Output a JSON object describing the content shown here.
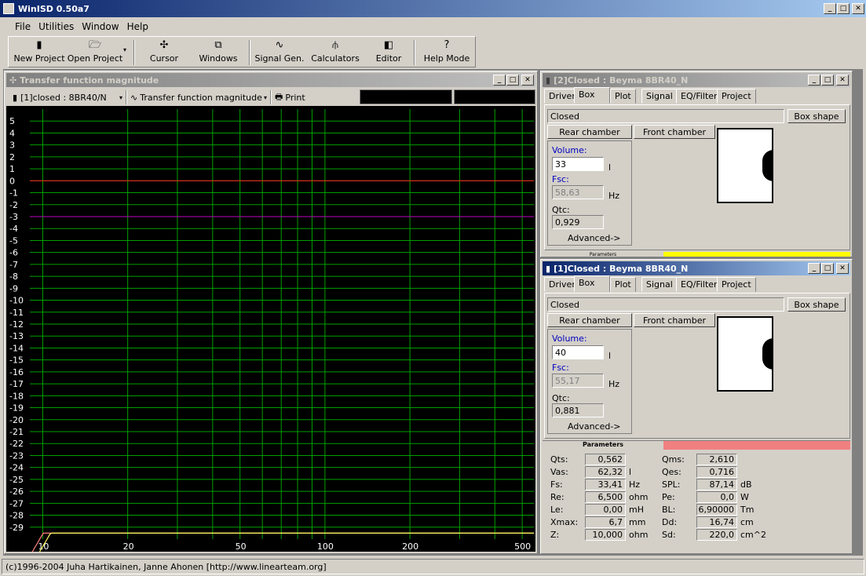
{
  "app_title": "WinISD 0.50a7",
  "menu": [
    "File",
    "Utilities",
    "Window",
    "Help"
  ],
  "toolbar": {
    "new_project": "New Project",
    "open_project": "Open Project",
    "cursor": "Cursor",
    "windows": "Windows",
    "signal_gen": "Signal Gen.",
    "calculators": "Calculators",
    "editor": "Editor",
    "help_mode": "Help Mode"
  },
  "graph_window": {
    "title": "Transfer function magnitude",
    "project_select": "[1]closed : 8BR40/N",
    "graph_select": "Transfer function magnitude",
    "print_label": "Print"
  },
  "box2": {
    "title": "[2]Closed : Beyma 8BR40_N",
    "tabs": [
      "Driver",
      "Box",
      "Plot",
      "Signal",
      "EQ/Filter",
      "Project"
    ],
    "box_type": "Closed",
    "box_shape_btn": "Box shape",
    "rear_chamber_btn": "Rear chamber",
    "front_chamber_btn": "Front chamber",
    "volume_label": "Volume:",
    "volume_value": "33",
    "volume_unit": "l",
    "fsc_label": "Fsc:",
    "fsc_value": "58,63",
    "fsc_unit": "Hz",
    "qtc_label": "Qtc:",
    "qtc_value": "0,929",
    "advanced_btn": "Advanced->",
    "params_label": "Parameters"
  },
  "box1": {
    "title": "[1]Closed : Beyma 8BR40_N",
    "tabs": [
      "Driver",
      "Box",
      "Plot",
      "Signal",
      "EQ/Filter",
      "Project"
    ],
    "box_type": "Closed",
    "box_shape_btn": "Box shape",
    "rear_chamber_btn": "Rear chamber",
    "front_chamber_btn": "Front chamber",
    "volume_label": "Volume:",
    "volume_value": "40",
    "volume_unit": "l",
    "fsc_label": "Fsc:",
    "fsc_value": "55,17",
    "fsc_unit": "Hz",
    "qtc_label": "Qtc:",
    "qtc_value": "0,881",
    "advanced_btn": "Advanced->"
  },
  "parameters": {
    "header": "Parameters",
    "left": [
      {
        "name": "Qts:",
        "value": "0,562",
        "unit": ""
      },
      {
        "name": "Vas:",
        "value": "62,32",
        "unit": "l"
      },
      {
        "name": "Fs:",
        "value": "33,41",
        "unit": "Hz"
      },
      {
        "name": "Re:",
        "value": "6,500",
        "unit": "ohm"
      },
      {
        "name": "Le:",
        "value": "0,00",
        "unit": "mH"
      },
      {
        "name": "Xmax:",
        "value": "6,7",
        "unit": "mm"
      },
      {
        "name": "Z:",
        "value": "10,000",
        "unit": "ohm"
      }
    ],
    "right": [
      {
        "name": "Qms:",
        "value": "2,610",
        "unit": ""
      },
      {
        "name": "Qes:",
        "value": "0,716",
        "unit": ""
      },
      {
        "name": "SPL:",
        "value": "87,14",
        "unit": "dB"
      },
      {
        "name": "Pe:",
        "value": "0,0",
        "unit": "W"
      },
      {
        "name": "BL:",
        "value": "6,90000",
        "unit": "Tm"
      },
      {
        "name": "Dd:",
        "value": "16,74",
        "unit": "cm"
      },
      {
        "name": "Sd:",
        "value": "220,0",
        "unit": "cm^2"
      }
    ]
  },
  "status_bar": "(c)1996-2004 Juha Hartikainen, Janne Ahonen [http://www.linearteam.org]",
  "chart_data": {
    "type": "line",
    "x_scale": "log",
    "xlim": [
      9,
      550
    ],
    "ylim": [
      -30,
      6
    ],
    "x_ticks": [
      10,
      20,
      50,
      100,
      200,
      500
    ],
    "y_ticks": [
      5,
      4,
      3,
      2,
      1,
      0,
      -1,
      -2,
      -3,
      -4,
      -5,
      -6,
      -7,
      -8,
      -9,
      -10,
      -11,
      -12,
      -13,
      -14,
      -15,
      -16,
      -17,
      -18,
      -19,
      -20,
      -21,
      -22,
      -23,
      -24,
      -25,
      -26,
      -27,
      -28,
      -29
    ],
    "grid": true,
    "reference_lines": [
      {
        "y": 0,
        "color": "#ff2020"
      },
      {
        "y": -3,
        "color": "#c000c0"
      }
    ],
    "series": [
      {
        "color": "#ff8080",
        "fc": 55.17,
        "qtc": 0.881
      },
      {
        "color": "#ffff60",
        "fc": 58.63,
        "qtc": 0.929
      }
    ],
    "colors": {
      "background": "#000000",
      "grid": "#00a000",
      "text": "#ffffff"
    }
  }
}
